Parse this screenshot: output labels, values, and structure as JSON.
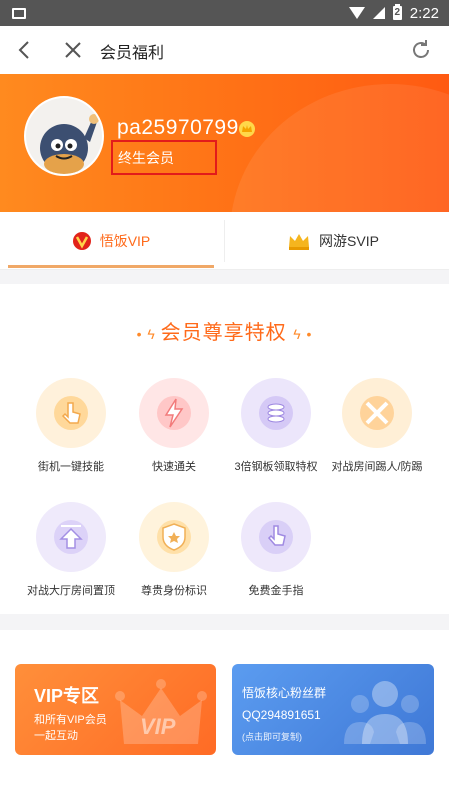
{
  "status_bar": {
    "time": "2:22",
    "battery_level": "2"
  },
  "nav": {
    "title": "会员福利"
  },
  "profile": {
    "username": "pa25970799",
    "member_status": "终生会员"
  },
  "tabs": [
    {
      "label": "悟饭VIP",
      "active": true
    },
    {
      "label": "网游SVIP",
      "active": false
    }
  ],
  "privileges": {
    "title": "会员尊享特权",
    "items": [
      {
        "label": "街机一键技能",
        "icon": "tap-icon",
        "color": "#ffe9c9"
      },
      {
        "label": "快速通关",
        "icon": "lightning-icon",
        "color": "#ffe0e0"
      },
      {
        "label": "3倍钢板领取特权",
        "icon": "coins-icon",
        "color": "#e8e2fb"
      },
      {
        "label": "对战房间踢人/防踢",
        "icon": "swords-icon",
        "color": "#ffeacc"
      },
      {
        "label": "对战大厅房间置顶",
        "icon": "arrow-up-icon",
        "color": "#ece6fb"
      },
      {
        "label": "尊贵身份标识",
        "icon": "shield-star-icon",
        "color": "#fff0d6"
      },
      {
        "label": "免费金手指",
        "icon": "pointer-icon",
        "color": "#ebe5fb"
      }
    ]
  },
  "cards": {
    "vip": {
      "title": "VIP专区",
      "desc_line1": "和所有VIP会员",
      "desc_line2": "一起互动",
      "watermark": "VIP"
    },
    "fans": {
      "title": "悟饭核心粉丝群",
      "qq": "QQ294891651",
      "hint": "(点击即可复制)"
    }
  },
  "colors": {
    "accent": "#ff6a1a",
    "highlight_box": "#e21b1b",
    "vip_card": "#ff7a2e",
    "fans_card": "#4a86e0"
  }
}
